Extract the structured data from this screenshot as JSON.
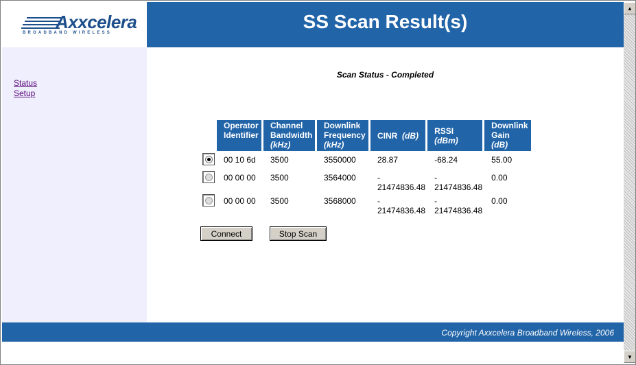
{
  "logo": {
    "name": "Axxcelera",
    "tagline": "BROADBAND WIRELESS"
  },
  "header": {
    "title": "SS Scan Result(s)"
  },
  "sidebar": {
    "items": [
      {
        "label": "Status"
      },
      {
        "label": "Setup"
      }
    ]
  },
  "scan_status": "Scan Status - Completed",
  "table": {
    "headers": [
      {
        "main": "Operator Identifier",
        "unit": ""
      },
      {
        "main": "Channel Bandwidth",
        "unit": "(kHz)"
      },
      {
        "main": "Downlink Frequency",
        "unit": "(kHz)"
      },
      {
        "main": "CINR",
        "unit": "(dB)"
      },
      {
        "main": "RSSI",
        "unit": "(dBm)"
      },
      {
        "main": "Downlink Gain",
        "unit": "(dB)"
      }
    ],
    "rows": [
      {
        "selected": true,
        "operator": "00 10 6d",
        "bandwidth": "3500",
        "frequency": "3550000",
        "cinr": "28.87",
        "rssi": "-68.24",
        "gain": "55.00"
      },
      {
        "selected": false,
        "operator": "00 00 00",
        "bandwidth": "3500",
        "frequency": "3564000",
        "cinr": "-\n21474836.48",
        "rssi": "-\n21474836.48",
        "gain": "0.00"
      },
      {
        "selected": false,
        "operator": "00 00 00",
        "bandwidth": "3500",
        "frequency": "3568000",
        "cinr": "-\n21474836.48",
        "rssi": "-\n21474836.48",
        "gain": "0.00"
      }
    ]
  },
  "buttons": {
    "connect": "Connect",
    "stop_scan": "Stop Scan"
  },
  "footer": {
    "copyright": "Copyright Axxcelera Broadband Wireless, 2006"
  },
  "colors": {
    "brand_blue": "#2164a8",
    "sidebar_bg": "#efeffd",
    "link": "#5a0a7a"
  }
}
